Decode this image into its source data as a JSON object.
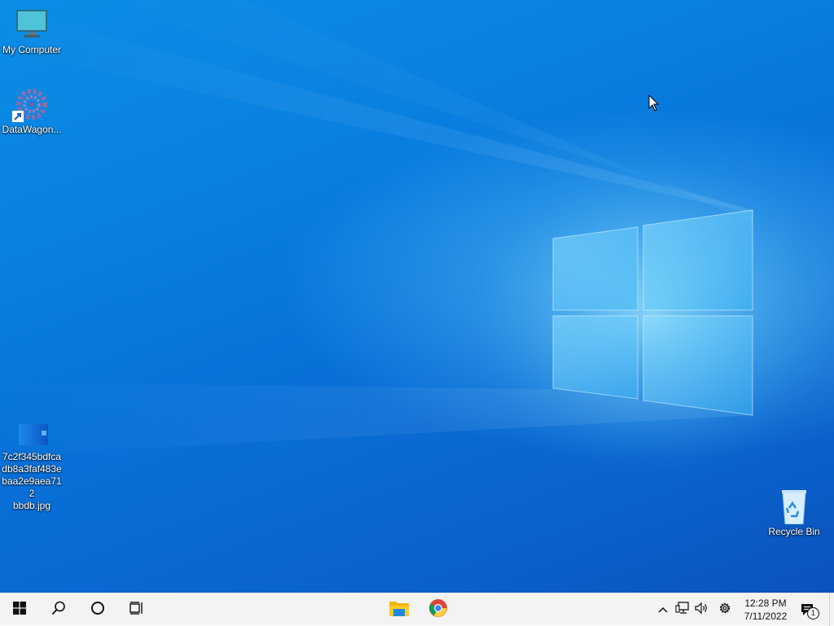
{
  "desktop": {
    "icons": [
      {
        "label": "My Computer",
        "icon": "monitor-icon"
      },
      {
        "label": "DataWagon...",
        "icon": "gear-cluster-shortcut-icon"
      },
      {
        "label": "7c2f345bdfca\ndb8a3faf483e\nbaa2e9aea712\nbbdb.jpg",
        "icon": "image-file-icon"
      },
      {
        "label": "Recycle Bin",
        "icon": "recycle-bin-icon"
      }
    ]
  },
  "taskbar": {
    "start": "windows-logo-icon",
    "search": "search-icon",
    "cortana": "cortana-circle-icon",
    "task_view": "task-view-icon",
    "pinned": [
      "file-explorer-icon",
      "chrome-icon"
    ],
    "tray": [
      "chevron-up-icon",
      "network-icon",
      "volume-icon",
      "settings-gear-icon"
    ],
    "clock": {
      "time": "12:28 PM",
      "date": "7/11/2022"
    },
    "notifications": {
      "icon": "action-center-icon",
      "count": "1"
    }
  },
  "colors": {
    "taskbar_bg": "#f3f3f3",
    "desktop_accent": "#0a7fe0"
  }
}
